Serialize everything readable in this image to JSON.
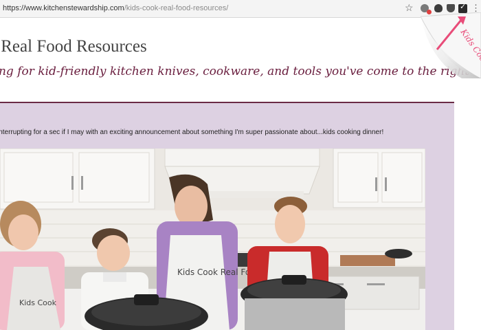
{
  "browser": {
    "url_host": "https://www.kitchenstewardship.com",
    "url_path": "/kids-cook-real-food-resources/",
    "bookmark_icon": "star-icon",
    "extension_icons": [
      "extension-icon",
      "extension-icon",
      "extension-icon",
      "checkmark-extension-icon"
    ],
    "menu_icon": "kebab-menu-icon"
  },
  "page": {
    "title": "ok Real Food Resources",
    "tagline": "oking for kid-friendly kitchen knives, cookware, and tools you've come to the right",
    "corner_tab_text": "Kids Cooking",
    "announcement": "interrupting for a sec if I may with an exciting announcement about something I'm super passionate about...kids cooking dinner!",
    "apron_text": "Kids Cook Real Food",
    "apron_text_short": "Kids Cook",
    "accent_color": "#6a2a45",
    "panel_color": "#ddd1e2"
  }
}
